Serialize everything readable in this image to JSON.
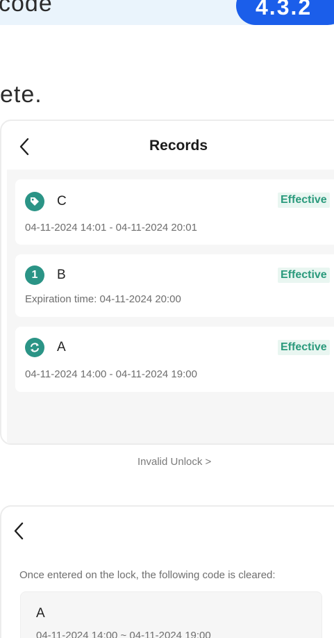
{
  "header": {
    "partial_title": "code",
    "version": "4.3.2"
  },
  "partial_text": "ete.",
  "records_panel": {
    "title": "Records",
    "items": [
      {
        "name": "C",
        "status": "Effective",
        "detail": "04-11-2024 14:01 - 04-11-2024 20:01",
        "icon": "tag-icon"
      },
      {
        "name": "B",
        "status": "Effective",
        "detail": "Expiration time: 04-11-2024 20:00",
        "icon": "one-time-icon",
        "icon_text": "1"
      },
      {
        "name": "A",
        "status": "Effective",
        "detail": "04-11-2024 14:00 - 04-11-2024 19:00",
        "icon": "cycle-icon"
      }
    ],
    "invalid_link": "Invalid Unlock  >"
  },
  "clear_panel": {
    "description": "Once entered on the lock, the following code is cleared:",
    "code": {
      "name": "A",
      "time": "04-11-2024 14:00 ~ 04-11-2024 19:00"
    }
  },
  "colors": {
    "brand_blue": "#1b5eea",
    "icon_teal": "#2b9486",
    "effective_green": "#2a9a7c",
    "effective_bg": "#e9f6f1"
  }
}
